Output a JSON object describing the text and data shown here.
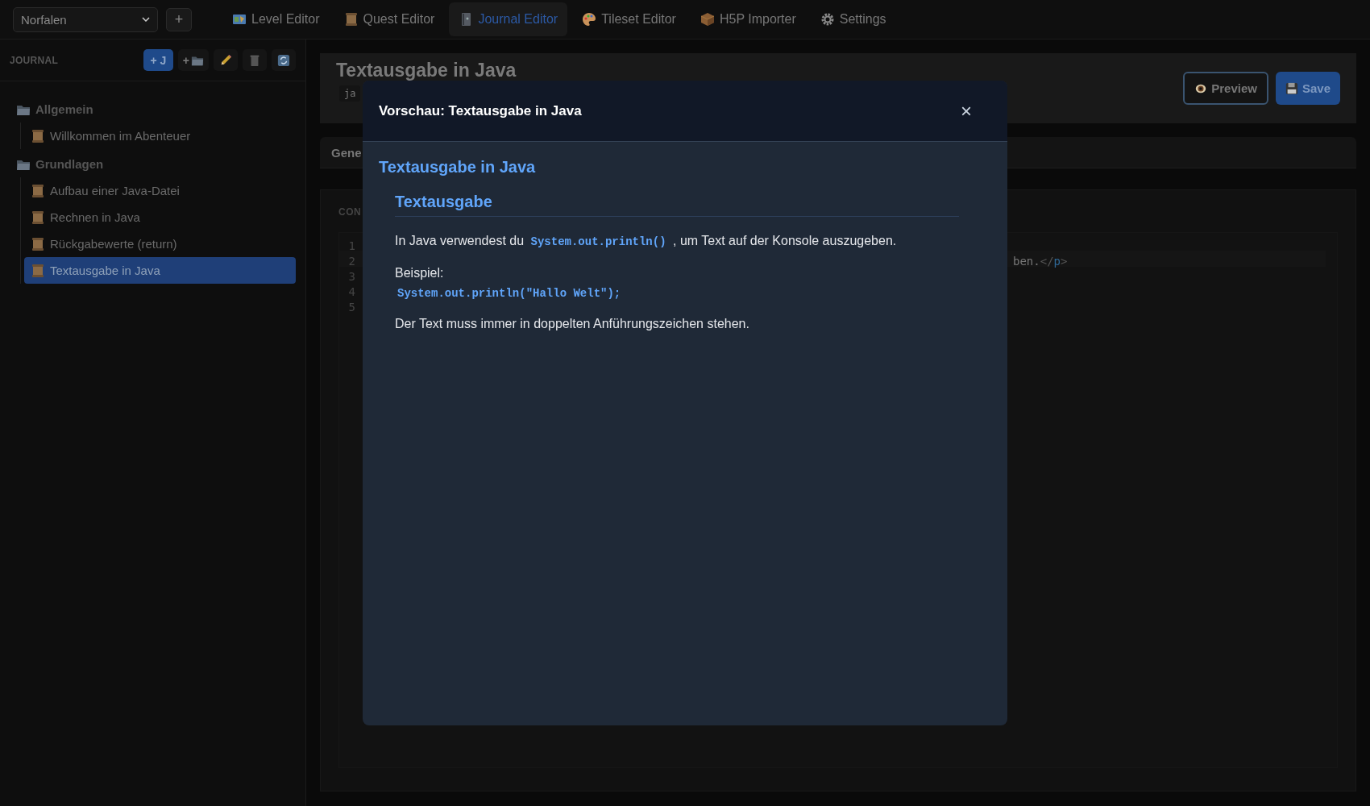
{
  "project_select": {
    "value": "Norfalen"
  },
  "add_project_button": {
    "label": "+"
  },
  "nav_tabs": [
    {
      "label": "Level Editor",
      "selected": false
    },
    {
      "label": "Quest Editor",
      "selected": false
    },
    {
      "label": "Journal Editor",
      "selected": true
    },
    {
      "label": "Tileset Editor",
      "selected": false
    },
    {
      "label": "H5P Importer",
      "selected": false
    },
    {
      "label": "Settings",
      "selected": false
    }
  ],
  "sidebar": {
    "title": "JOURNAL",
    "toolbar": [
      {
        "kind": "new-journal",
        "label": "+ J"
      },
      {
        "kind": "new-folder",
        "label": "+"
      },
      {
        "kind": "edit"
      },
      {
        "kind": "delete"
      },
      {
        "kind": "refresh"
      }
    ],
    "tree": [
      {
        "label": "Allgemein",
        "selected": false,
        "children": [
          {
            "label": "Willkommen im Abenteuer",
            "selected": false
          }
        ]
      },
      {
        "label": "Grundlagen",
        "selected": false,
        "children": [
          {
            "label": "Aufbau einer Java-Datei",
            "selected": false
          },
          {
            "label": "Rechnen in Java",
            "selected": false
          },
          {
            "label": "Rückgabewerte (return)",
            "selected": false
          },
          {
            "label": "Textausgabe in Java",
            "selected": true
          }
        ]
      }
    ]
  },
  "editor": {
    "title": "Textausgabe in Java",
    "tag": "ja",
    "buttons": [
      {
        "kind": "preview",
        "label": "Preview"
      },
      {
        "kind": "save",
        "label": "Save"
      }
    ],
    "tab": "Gene",
    "content_label": "CON",
    "line_numbers": [
      "1",
      "2",
      "3",
      "4",
      "5"
    ],
    "code_fragment": [
      {
        "kind": "text",
        "text": "ben."
      },
      {
        "kind": "punct",
        "text": "</"
      },
      {
        "kind": "tag",
        "text": "p"
      },
      {
        "kind": "punct",
        "text": ">"
      }
    ]
  },
  "modal": {
    "title": "Vorschau: Textausgabe in Java",
    "close": "×",
    "heading": "Textausgabe in Java",
    "section_heading": "Textausgabe",
    "blocks": [
      {
        "kind": "paragraph",
        "parts": [
          {
            "kind": "text",
            "text": "In Java verwendest du "
          },
          {
            "kind": "code",
            "text": "System.out.println()"
          },
          {
            "kind": "text",
            "text": " , um Text auf der Konsole auszugeben."
          }
        ]
      },
      {
        "kind": "paragraph",
        "parts": [
          {
            "kind": "text",
            "text": "Beispiel:"
          }
        ]
      },
      {
        "kind": "code",
        "text": "System.out.println(\"Hallo Welt\");"
      },
      {
        "kind": "paragraph",
        "parts": [
          {
            "kind": "text",
            "text": "Der Text muss immer in doppelten Anführungszeichen stehen."
          }
        ]
      }
    ]
  }
}
